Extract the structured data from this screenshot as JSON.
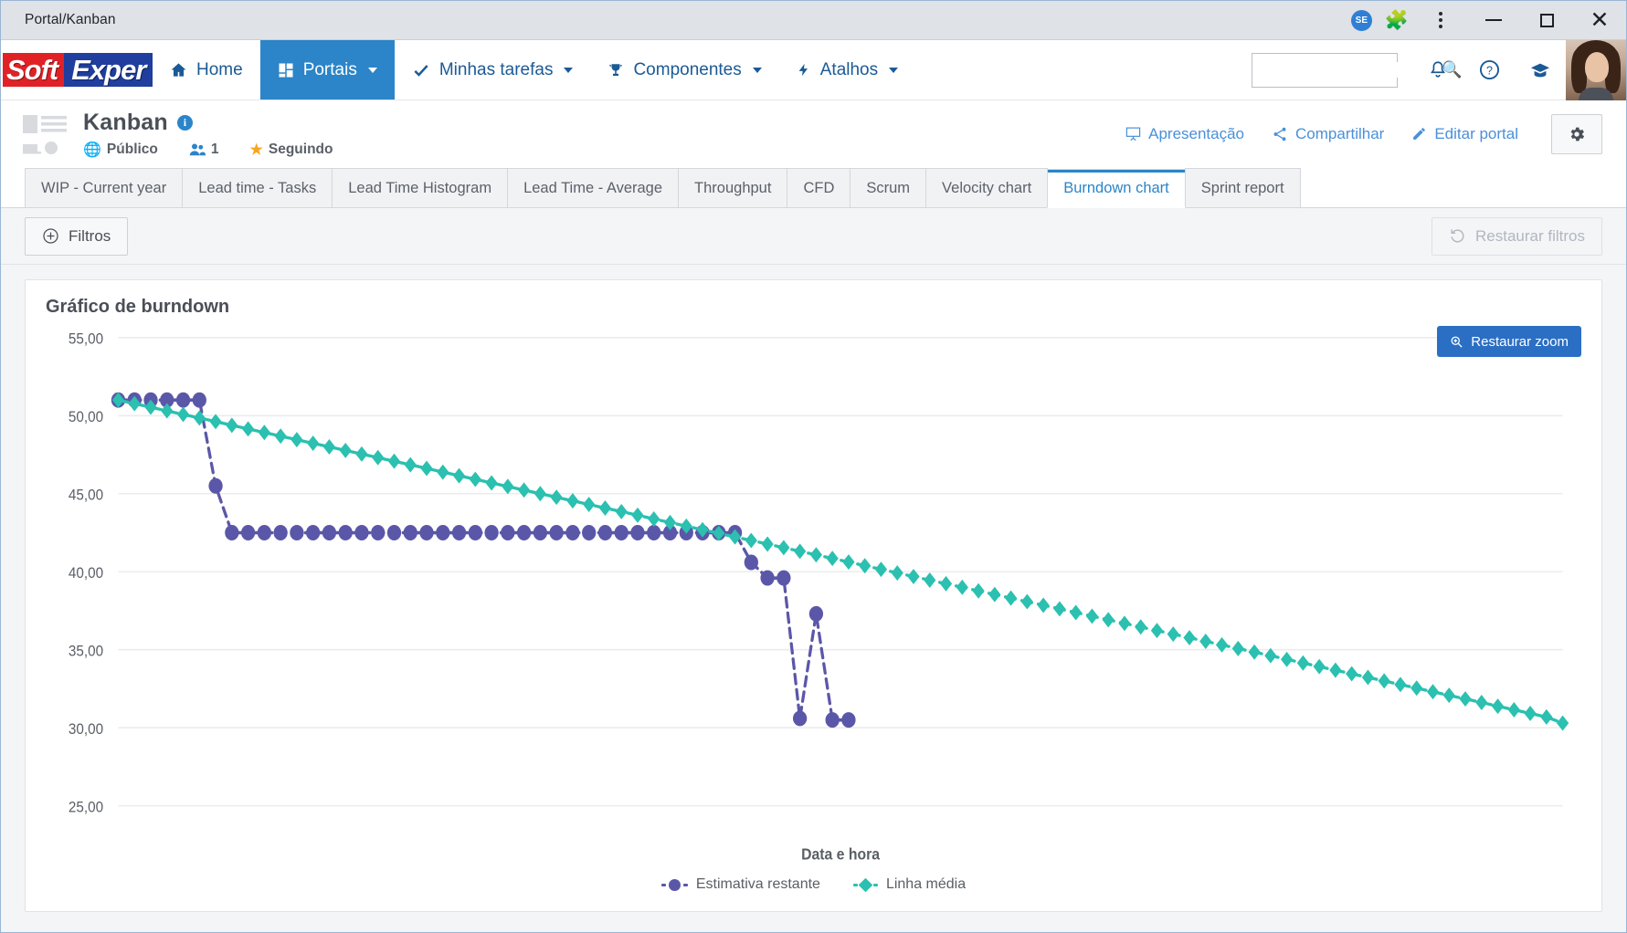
{
  "window": {
    "title": "Portal/Kanban",
    "badge": "SE",
    "icons": {
      "extensions": "puzzle-icon",
      "menu": "kebab-menu-icon",
      "minimize": "minimize-icon",
      "maximize": "maximize-icon",
      "close": "close-icon"
    }
  },
  "appbar": {
    "logo": {
      "part1": "Soft",
      "part2": "Exper"
    },
    "nav": [
      {
        "label": "Home",
        "icon": "home-icon",
        "caret": false,
        "active": false
      },
      {
        "label": "Portais",
        "icon": "grid-icon",
        "caret": true,
        "active": true
      },
      {
        "label": "Minhas tarefas",
        "icon": "check-icon",
        "caret": true,
        "active": false
      },
      {
        "label": "Componentes",
        "icon": "trophy-icon",
        "caret": true,
        "active": false
      },
      {
        "label": "Atalhos",
        "icon": "bolt-icon",
        "caret": true,
        "active": false
      }
    ],
    "search": {
      "value": "",
      "placeholder": ""
    },
    "right_icons": [
      "bell-icon",
      "help-icon",
      "graduation-cap-icon",
      "avatar"
    ]
  },
  "portal": {
    "title": "Kanban",
    "visibility": "Público",
    "members": "1",
    "following": "Seguindo",
    "actions": [
      {
        "label": "Apresentação",
        "icon": "presentation-icon"
      },
      {
        "label": "Compartilhar",
        "icon": "share-icon"
      },
      {
        "label": "Editar portal",
        "icon": "pencil-icon"
      }
    ],
    "settings_icon": "gear-icon"
  },
  "tabs": [
    {
      "label": "WIP - Current year",
      "active": false
    },
    {
      "label": "Lead time - Tasks",
      "active": false
    },
    {
      "label": "Lead Time Histogram",
      "active": false
    },
    {
      "label": "Lead Time - Average",
      "active": false
    },
    {
      "label": "Throughput",
      "active": false
    },
    {
      "label": "CFD",
      "active": false
    },
    {
      "label": "Scrum",
      "active": false
    },
    {
      "label": "Velocity chart",
      "active": false
    },
    {
      "label": "Burndown chart",
      "active": true
    },
    {
      "label": "Sprint report",
      "active": false
    }
  ],
  "toolbar": {
    "filters_label": "Filtros",
    "filters_icon": "plus-circle-icon",
    "restore_label": "Restaurar filtros",
    "restore_icon": "undo-icon"
  },
  "card": {
    "title": "Gráfico de burndown",
    "zoom_button": "Restaurar zoom",
    "zoom_icon": "magnifier-plus-icon"
  },
  "colors": {
    "accent_blue": "#2b85c8",
    "purple_series": "#5b57a8",
    "teal_series": "#2bc0b0",
    "button_blue": "#2b6fc4",
    "logo_red": "#e02226",
    "logo_blue": "#1f3e9e",
    "star_orange": "#f5a623"
  },
  "chart_data": {
    "type": "line",
    "title": "Gráfico de burndown",
    "xlabel": "Data e hora",
    "ylabel": "",
    "ylim": [
      25,
      55
    ],
    "yticks": [
      "25,00",
      "30,00",
      "35,00",
      "40,00",
      "45,00",
      "50,00",
      "55,00"
    ],
    "ytick_values": [
      25,
      30,
      35,
      40,
      45,
      50,
      55
    ],
    "grid": "horizontal",
    "legend_position": "bottom",
    "xtick_labels": [],
    "series": [
      {
        "name": "Estimativa restante",
        "color": "#5b57a8",
        "marker": "circle",
        "linestyle": "dashed",
        "x": [
          1,
          2,
          3,
          4,
          5,
          6,
          7,
          8,
          9,
          10,
          11,
          12,
          13,
          14,
          15,
          16,
          17,
          18,
          19,
          20,
          21,
          22,
          23,
          24,
          25,
          26,
          27,
          28,
          29,
          30,
          31,
          32,
          33,
          34,
          35,
          36,
          37,
          38,
          39,
          40,
          41,
          42,
          43,
          44,
          45,
          46
        ],
        "values": [
          51.0,
          51.0,
          51.0,
          51.0,
          51.0,
          51.0,
          45.5,
          42.5,
          42.5,
          42.5,
          42.5,
          42.5,
          42.5,
          42.5,
          42.5,
          42.5,
          42.5,
          42.5,
          42.5,
          42.5,
          42.5,
          42.5,
          42.5,
          42.5,
          42.5,
          42.5,
          42.5,
          42.5,
          42.5,
          42.5,
          42.5,
          42.5,
          42.5,
          42.5,
          42.5,
          42.5,
          42.5,
          42.5,
          42.5,
          40.6,
          39.6,
          39.6,
          30.6,
          37.3,
          30.5,
          30.5
        ]
      },
      {
        "name": "Linha média",
        "color": "#2bc0b0",
        "marker": "diamond",
        "linestyle": "dashed",
        "x": [
          1,
          2,
          3,
          4,
          5,
          6,
          7,
          8,
          9,
          10,
          11,
          12,
          13,
          14,
          15,
          16,
          17,
          18,
          19,
          20,
          21,
          22,
          23,
          24,
          25,
          26,
          27,
          28,
          29,
          30,
          31,
          32,
          33,
          34,
          35,
          36,
          37,
          38,
          39,
          40,
          41,
          42,
          43,
          44,
          45,
          46,
          47,
          48,
          49,
          50,
          51,
          52,
          53,
          54,
          55,
          56,
          57,
          58,
          59,
          60,
          61,
          62,
          63,
          64,
          65,
          66,
          67,
          68,
          69,
          70,
          71,
          72,
          73,
          74,
          75,
          76,
          77,
          78,
          79,
          80,
          81,
          82,
          83,
          84,
          85,
          86,
          87,
          88,
          89,
          90
        ],
        "values": [
          51.0,
          50.77,
          50.54,
          50.31,
          50.08,
          49.85,
          49.62,
          49.38,
          49.15,
          48.92,
          48.69,
          48.46,
          48.23,
          48.0,
          47.77,
          47.54,
          47.31,
          47.08,
          46.85,
          46.62,
          46.38,
          46.15,
          45.92,
          45.69,
          45.46,
          45.23,
          45.0,
          44.77,
          44.54,
          44.31,
          44.08,
          43.85,
          43.62,
          43.38,
          43.15,
          42.92,
          42.69,
          42.46,
          42.23,
          42.0,
          41.77,
          41.54,
          41.31,
          41.08,
          40.85,
          40.62,
          40.38,
          40.15,
          39.92,
          39.69,
          39.46,
          39.23,
          39.0,
          38.77,
          38.54,
          38.31,
          38.08,
          37.85,
          37.62,
          37.38,
          37.15,
          36.92,
          36.69,
          36.46,
          36.23,
          36.0,
          35.77,
          35.54,
          35.31,
          35.08,
          34.85,
          34.62,
          34.38,
          34.15,
          33.92,
          33.69,
          33.46,
          33.23,
          33.0,
          32.77,
          32.54,
          32.31,
          32.08,
          31.85,
          31.62,
          31.38,
          31.15,
          30.92,
          30.69,
          30.3
        ]
      }
    ],
    "legend": [
      "Estimativa restante",
      "Linha média"
    ]
  }
}
